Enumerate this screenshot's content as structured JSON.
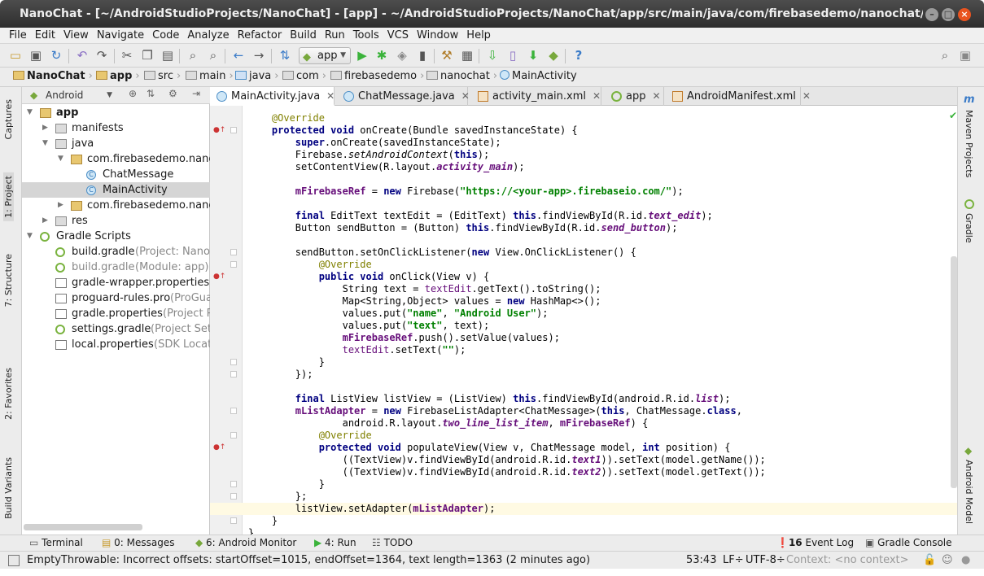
{
  "window": {
    "title": "NanoChat - [~/AndroidStudioProjects/NanoChat] - [app] - ~/AndroidStudioProjects/NanoChat/app/src/main/java/com/firebasedemo/nanochat/MainA"
  },
  "menu": [
    "File",
    "Edit",
    "View",
    "Navigate",
    "Code",
    "Analyze",
    "Refactor",
    "Build",
    "Run",
    "Tools",
    "VCS",
    "Window",
    "Help"
  ],
  "toolbar": {
    "run_config": "app"
  },
  "breadcrumb": [
    {
      "label": "NanoChat",
      "bold": true
    },
    {
      "label": "app",
      "bold": true
    },
    {
      "label": "src"
    },
    {
      "label": "main"
    },
    {
      "label": "java"
    },
    {
      "label": "com"
    },
    {
      "label": "firebasedemo"
    },
    {
      "label": "nanochat"
    },
    {
      "label": "MainActivity"
    }
  ],
  "left_tool_tabs": [
    "Captures",
    "1: Project",
    "7: Structure",
    "2: Favorites",
    "Build Variants"
  ],
  "right_tool_tabs": [
    "Maven Projects",
    "Gradle",
    "Android Model"
  ],
  "project": {
    "view_selector": "Android",
    "tree": [
      {
        "label": "app",
        "hint": "",
        "bold": true
      },
      {
        "label": "manifests",
        "hint": ""
      },
      {
        "label": "java",
        "hint": ""
      },
      {
        "label": "com.firebasedemo.nanochat",
        "hint": ""
      },
      {
        "label": "ChatMessage",
        "hint": ""
      },
      {
        "label": "MainActivity",
        "hint": ""
      },
      {
        "label": "com.firebasedemo.nanochat",
        "hint": ""
      },
      {
        "label": "res",
        "hint": ""
      },
      {
        "label": "Gradle Scripts",
        "hint": ""
      },
      {
        "label": "build.gradle",
        "hint": " (Project: NanoChat)"
      },
      {
        "label": "build.gradle",
        "hint": " (Module: app)"
      },
      {
        "label": "gradle-wrapper.properties",
        "hint": ""
      },
      {
        "label": "proguard-rules.pro",
        "hint": " (ProGuard Rules)"
      },
      {
        "label": "gradle.properties",
        "hint": " (Project Properties)"
      },
      {
        "label": "settings.gradle",
        "hint": " (Project Settings)"
      },
      {
        "label": "local.properties",
        "hint": " (SDK Location)"
      }
    ]
  },
  "tabs": [
    {
      "label": "MainActivity.java",
      "active": true
    },
    {
      "label": "ChatMessage.java"
    },
    {
      "label": "activity_main.xml"
    },
    {
      "label": "app"
    },
    {
      "label": "AndroidManifest.xml"
    }
  ],
  "code": [
    "    @Override",
    "    protected void onCreate(Bundle savedInstanceState) {",
    "        super.onCreate(savedInstanceState);",
    "        Firebase.setAndroidContext(this);",
    "        setContentView(R.layout.activity_main);",
    "",
    "        mFirebaseRef = new Firebase(\"https://<your-app>.firebaseio.com/\");",
    "",
    "        final EditText textEdit = (EditText) this.findViewById(R.id.text_edit);",
    "        Button sendButton = (Button) this.findViewById(R.id.send_button);",
    "",
    "        sendButton.setOnClickListener(new View.OnClickListener() {",
    "            @Override",
    "            public void onClick(View v) {",
    "                String text = textEdit.getText().toString();",
    "                Map<String,Object> values = new HashMap<>();",
    "                values.put(\"name\", \"Android User\");",
    "                values.put(\"text\", text);",
    "                mFirebaseRef.push().setValue(values);",
    "                textEdit.setText(\"\");",
    "            }",
    "        });",
    "",
    "        final ListView listView = (ListView) this.findViewById(android.R.id.list);",
    "        mListAdapter = new FirebaseListAdapter<ChatMessage>(this, ChatMessage.class,",
    "                android.R.layout.two_line_list_item, mFirebaseRef) {",
    "            @Override",
    "            protected void populateView(View v, ChatMessage model, int position) {",
    "                ((TextView)v.findViewById(android.R.id.text1)).setText(model.getName());",
    "                ((TextView)v.findViewById(android.R.id.text2)).setText(model.getText());",
    "            }",
    "        };",
    "        listView.setAdapter(mListAdapter);",
    "    }",
    "}"
  ],
  "bottom_tools": [
    "Terminal",
    "0: Messages",
    "6: Android Monitor",
    "4: Run",
    "TODO",
    "16",
    "Event Log",
    "Gradle Console"
  ],
  "status": {
    "message": "EmptyThrowable: Incorrect offsets: startOffset=1015, endOffset=1364, text length=1363 (2 minutes ago)",
    "position": "53:43",
    "line_sep": "LF÷",
    "encoding": "UTF-8÷",
    "context": "Context: <no context>"
  },
  "colors": {
    "keyword": "#000080",
    "annotation": "#808000",
    "string": "#008000",
    "field": "#660e7a",
    "close_button": "#e95420"
  }
}
